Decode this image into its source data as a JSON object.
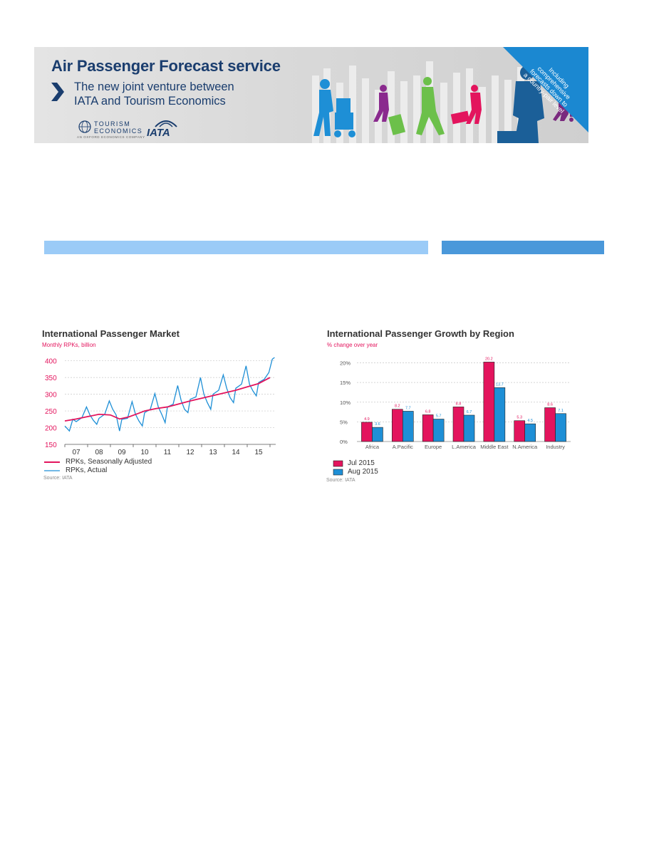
{
  "banner": {
    "title": "Air Passenger Forecast service",
    "subtitle_line1": "The new joint venture between",
    "subtitle_line2": "IATA and Tourism Economics",
    "te_logo_line1": "TOURISM",
    "te_logo_line2": "ECONOMICS",
    "te_logo_tag": "AN OXFORD ECONOMICS COMPANY",
    "iata_logo": "IATA",
    "ribbon_lines": [
      "Including",
      "comprehensive",
      "forecasts down to",
      "a country-pair level"
    ],
    "colors": {
      "navy": "#1a3d6e",
      "ribbon": "#1b88d1"
    }
  },
  "chart_data": [
    {
      "type": "line",
      "title": "International Passenger Market",
      "subtitle": "Monthly RPKs, billion",
      "source": "Source: IATA",
      "x_tick_labels": [
        "07",
        "08",
        "09",
        "10",
        "11",
        "12",
        "13",
        "14",
        "15"
      ],
      "y_ticks": [
        150,
        200,
        250,
        300,
        350,
        400
      ],
      "ylim": [
        150,
        410
      ],
      "x_range": [
        2006.5,
        2015.75
      ],
      "grid": "horizontal dashed",
      "legend_position": "bottom",
      "colors": {
        "Seasonally Adjusted": "#e3145d",
        "Actual": "#1e8fd6"
      },
      "series": [
        {
          "name": "RPKs, Seasonally Adjusted",
          "x": [
            2006.5,
            2007.0,
            2007.5,
            2008.0,
            2008.5,
            2008.9,
            2009.3,
            2009.7,
            2010.0,
            2010.5,
            2011.0,
            2011.5,
            2012.0,
            2012.5,
            2013.0,
            2013.5,
            2014.0,
            2014.5,
            2015.0,
            2015.5
          ],
          "values": [
            220,
            226,
            233,
            240,
            238,
            226,
            232,
            242,
            250,
            257,
            262,
            271,
            280,
            288,
            296,
            304,
            312,
            322,
            332,
            350
          ]
        },
        {
          "name": "RPKs, Actual",
          "x": [
            2006.5,
            2006.7,
            2006.85,
            2007.0,
            2007.25,
            2007.45,
            2007.6,
            2007.75,
            2007.9,
            2008.0,
            2008.25,
            2008.45,
            2008.6,
            2008.75,
            2008.9,
            2009.0,
            2009.25,
            2009.45,
            2009.6,
            2009.75,
            2009.9,
            2010.0,
            2010.25,
            2010.45,
            2010.6,
            2010.75,
            2010.9,
            2011.0,
            2011.25,
            2011.45,
            2011.6,
            2011.75,
            2011.9,
            2012.0,
            2012.25,
            2012.45,
            2012.6,
            2012.75,
            2012.9,
            2013.0,
            2013.25,
            2013.45,
            2013.6,
            2013.75,
            2013.9,
            2014.0,
            2014.25,
            2014.45,
            2014.6,
            2014.75,
            2014.9,
            2015.0,
            2015.25,
            2015.45,
            2015.6,
            2015.7
          ],
          "values": [
            205,
            190,
            225,
            218,
            230,
            262,
            238,
            222,
            210,
            228,
            240,
            280,
            255,
            238,
            190,
            225,
            228,
            278,
            240,
            220,
            205,
            245,
            255,
            302,
            262,
            240,
            215,
            262,
            270,
            326,
            282,
            255,
            245,
            285,
            292,
            350,
            300,
            275,
            255,
            300,
            312,
            358,
            318,
            290,
            275,
            318,
            330,
            385,
            330,
            310,
            295,
            335,
            345,
            365,
            405,
            410
          ]
        }
      ]
    },
    {
      "type": "bar",
      "title": "International Passenger Growth by Region",
      "subtitle": "% change over year",
      "source": "Source: IATA",
      "categories": [
        "Africa",
        "A.Pacific",
        "Europe",
        "L.America",
        "Middle East",
        "N.America",
        "Industry"
      ],
      "y_ticks": [
        "0%",
        "5%",
        "10%",
        "15%",
        "20%"
      ],
      "ylim": [
        0,
        21
      ],
      "grid": "horizontal dashed",
      "legend_position": "bottom-left",
      "colors": {
        "Jul 2015": "#e3145d",
        "Aug 2015": "#1e8fd6"
      },
      "series": [
        {
          "name": "Jul 2015",
          "values": [
            4.9,
            8.2,
            6.8,
            8.8,
            20.2,
            5.3,
            8.6
          ],
          "labels": [
            "4.9",
            "8.2",
            "6.8",
            "8.8",
            "20.2",
            "5.3",
            "8.6"
          ]
        },
        {
          "name": "Aug 2015",
          "values": [
            3.6,
            7.7,
            5.7,
            6.7,
            13.7,
            4.5,
            7.1
          ],
          "labels": [
            "3.6",
            "7.7",
            "5.7",
            "6.7",
            "13.7",
            "4.5",
            "7.1"
          ]
        }
      ]
    }
  ]
}
